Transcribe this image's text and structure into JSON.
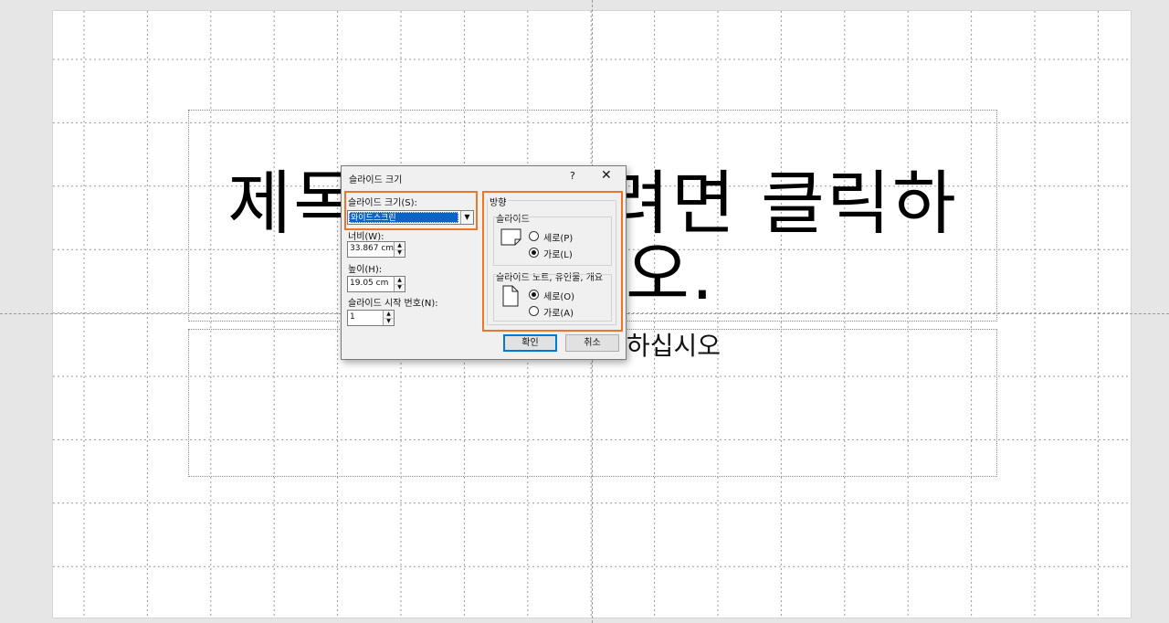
{
  "slide": {
    "title_placeholder": "제목을 추가하려면 클릭하십시오.",
    "title_visible_line1_left": "제목",
    "title_visible_line1_right": "려면 클릭하",
    "title_visible_line2": "오.",
    "subtitle_visible": "하십시오"
  },
  "dialog": {
    "title": "슬라이드 크기",
    "help_label": "?",
    "close_label": "✕",
    "size": {
      "label": "슬라이드 크기(S):",
      "selected": "와이드스크린"
    },
    "width": {
      "label": "너비(W):",
      "value": "33.867 cm"
    },
    "height": {
      "label": "높이(H):",
      "value": "19.05 cm"
    },
    "start_number": {
      "label": "슬라이드 시작 번호(N):",
      "value": "1"
    },
    "orientation": {
      "label": "방향",
      "slides": {
        "label": "슬라이드",
        "portrait": "세로(P)",
        "landscape": "가로(L)",
        "selected": "landscape"
      },
      "notes": {
        "label": "슬라이드 노트, 유인물, 개요",
        "portrait": "세로(O)",
        "landscape": "가로(A)",
        "selected": "portrait"
      }
    },
    "ok_label": "확인",
    "cancel_label": "취소"
  },
  "colors": {
    "highlight": "#e8762b",
    "selection": "#0a64c8"
  }
}
